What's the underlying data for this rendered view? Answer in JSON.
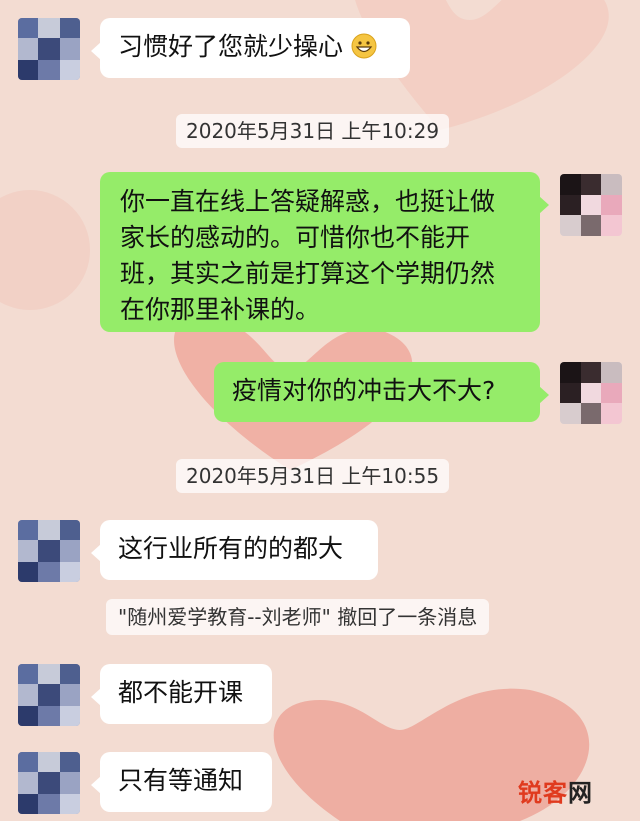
{
  "colors": {
    "background": "#f3dcd2",
    "heart": "#ee9a8d",
    "bubble_in": "#ffffff",
    "bubble_out": "#95ec69"
  },
  "messages": [
    {
      "side": "in",
      "text": "习惯好了您就少操心",
      "emoji": "grinning-face-emoji"
    },
    {
      "side": "out",
      "lines": [
        "你一直在线上答疑解惑，也挺让做",
        "家长的感动的。可惜你也不能开",
        "班，其实之前是打算这个学期仍然",
        "在你那里补课的。"
      ]
    },
    {
      "side": "out",
      "text": "疫情对你的冲击大不大?"
    },
    {
      "side": "in",
      "text": "这行业所有的的都大"
    },
    {
      "side": "in",
      "text": "都不能开课"
    },
    {
      "side": "in",
      "text": "只有等通知"
    }
  ],
  "timestamps": [
    "2020年5月31日 上午10:29",
    "2020年5月31日 上午10:55"
  ],
  "system_notice": "\"随州爱学教育--刘老师\" 撤回了一条消息",
  "watermark": {
    "part1": "锐客",
    "part2": "网"
  }
}
